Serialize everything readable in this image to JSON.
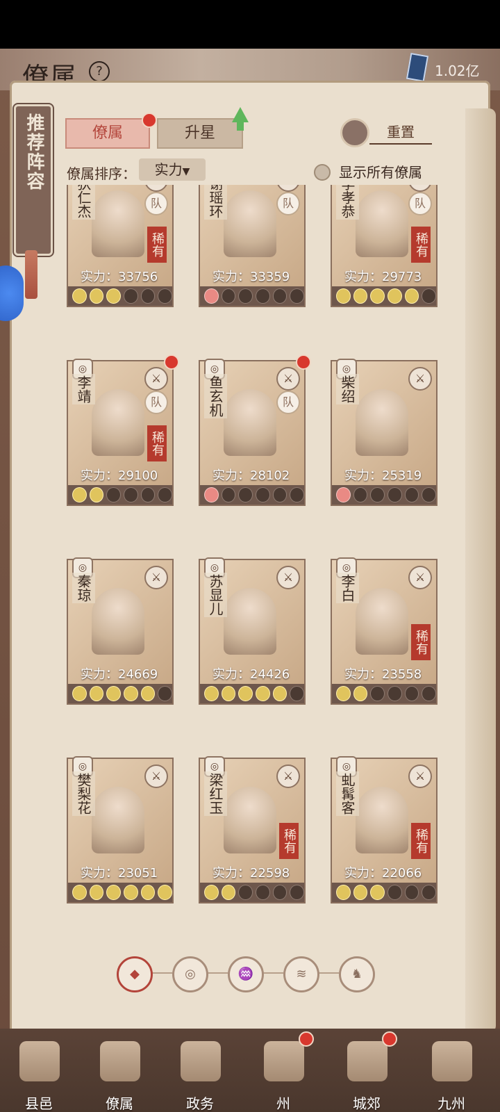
{
  "header": {
    "title": "僚属",
    "help_icon": "question-mark",
    "currency_value": "1.02亿"
  },
  "sidebar": {
    "recommend_label": "推荐阵容"
  },
  "tabs": [
    {
      "label": "僚属",
      "active": true
    },
    {
      "label": "升星",
      "active": false
    }
  ],
  "reset": {
    "label": "重置"
  },
  "sort": {
    "label": "僚属排序：",
    "selected": "实力"
  },
  "toggle": {
    "label": "显示所有僚属",
    "checked": false
  },
  "cards": [
    {
      "name": "狄仁杰",
      "power": "实力：33756",
      "rarity": "稀有",
      "stars_on": 3,
      "team": "队",
      "red_dot": false
    },
    {
      "name": "谢瑶环",
      "power": "实力：33359",
      "rarity": "",
      "stars_on": 1,
      "team": "队",
      "red_dot": false
    },
    {
      "name": "李孝恭",
      "power": "实力：29773",
      "rarity": "稀有",
      "stars_on": 5,
      "team": "队",
      "red_dot": false
    },
    {
      "name": "李靖",
      "power": "实力：29100",
      "rarity": "稀有",
      "stars_on": 2,
      "team": "队",
      "red_dot": true
    },
    {
      "name": "鱼玄机",
      "power": "实力：28102",
      "rarity": "",
      "stars_on": 1,
      "team": "队",
      "red_dot": true
    },
    {
      "name": "柴绍",
      "power": "实力：25319",
      "rarity": "",
      "stars_on": 1,
      "team": "",
      "red_dot": false
    },
    {
      "name": "秦琼",
      "power": "实力：24669",
      "rarity": "",
      "stars_on": 5,
      "team": "",
      "red_dot": false
    },
    {
      "name": "苏显儿",
      "power": "实力：24426",
      "rarity": "",
      "stars_on": 5,
      "team": "",
      "red_dot": false
    },
    {
      "name": "李白",
      "power": "实力：23558",
      "rarity": "稀有",
      "stars_on": 2,
      "team": "",
      "red_dot": false
    },
    {
      "name": "樊梨花",
      "power": "实力：23051",
      "rarity": "",
      "stars_on": 6,
      "team": "",
      "red_dot": false
    },
    {
      "name": "梁红玉",
      "power": "实力：22598",
      "rarity": "稀有",
      "stars_on": 2,
      "team": "",
      "red_dot": false
    },
    {
      "name": "虬髯客",
      "power": "实力：22066",
      "rarity": "稀有",
      "stars_on": 3,
      "team": "",
      "red_dot": false
    }
  ],
  "filters": [
    {
      "name": "all",
      "symbol": "◆",
      "active": true
    },
    {
      "name": "bell",
      "symbol": "◎",
      "active": false
    },
    {
      "name": "gourd",
      "symbol": "♒",
      "active": false
    },
    {
      "name": "fan",
      "symbol": "≋",
      "active": false
    },
    {
      "name": "horse",
      "symbol": "♞",
      "active": false
    }
  ],
  "nav": [
    {
      "label": "县邑",
      "red_dot": false
    },
    {
      "label": "僚属",
      "red_dot": false
    },
    {
      "label": "政务",
      "red_dot": false
    },
    {
      "label": "州",
      "red_dot": true
    },
    {
      "label": "城郊",
      "red_dot": true
    },
    {
      "label": "九州",
      "red_dot": false
    }
  ]
}
